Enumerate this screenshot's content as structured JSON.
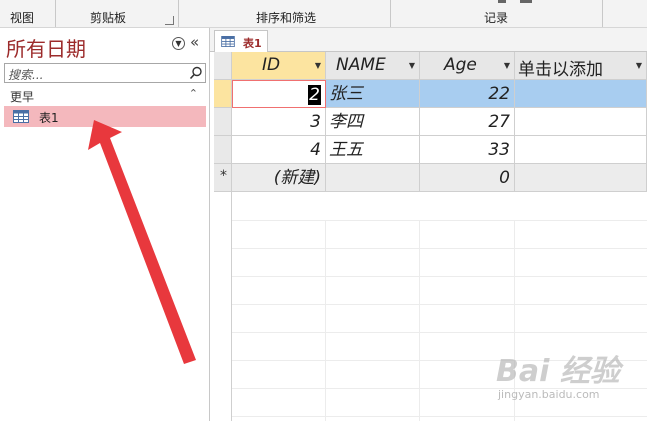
{
  "ribbon": {
    "groups": [
      "视图",
      "剪贴板",
      "排序和筛选",
      "记录"
    ]
  },
  "nav": {
    "title": "所有日期",
    "search_placeholder": "搜索...",
    "group_header": "更早",
    "items": [
      {
        "label": "表1",
        "selected": true
      }
    ]
  },
  "doc_tab": {
    "label": "表1"
  },
  "table": {
    "columns": [
      "ID",
      "NAME",
      "Age",
      "单击以添加"
    ],
    "rows": [
      {
        "id": "2",
        "name": "张三",
        "age": "22",
        "selected": true
      },
      {
        "id": "3",
        "name": "李四",
        "age": "27"
      },
      {
        "id": "4",
        "name": "王五",
        "age": "33"
      }
    ],
    "new_row": {
      "marker": "*",
      "id": "(新建)",
      "age": "0"
    }
  },
  "watermark": {
    "text": "Bai 经验",
    "url": "jingyan.baidu.com"
  },
  "colors": {
    "nav_title": "#9c2b2b",
    "nav_selected": "#f4b8bd",
    "row_selected": "#a8cdf0",
    "header_active": "#fce4a0",
    "arrow": "#e8383d"
  }
}
